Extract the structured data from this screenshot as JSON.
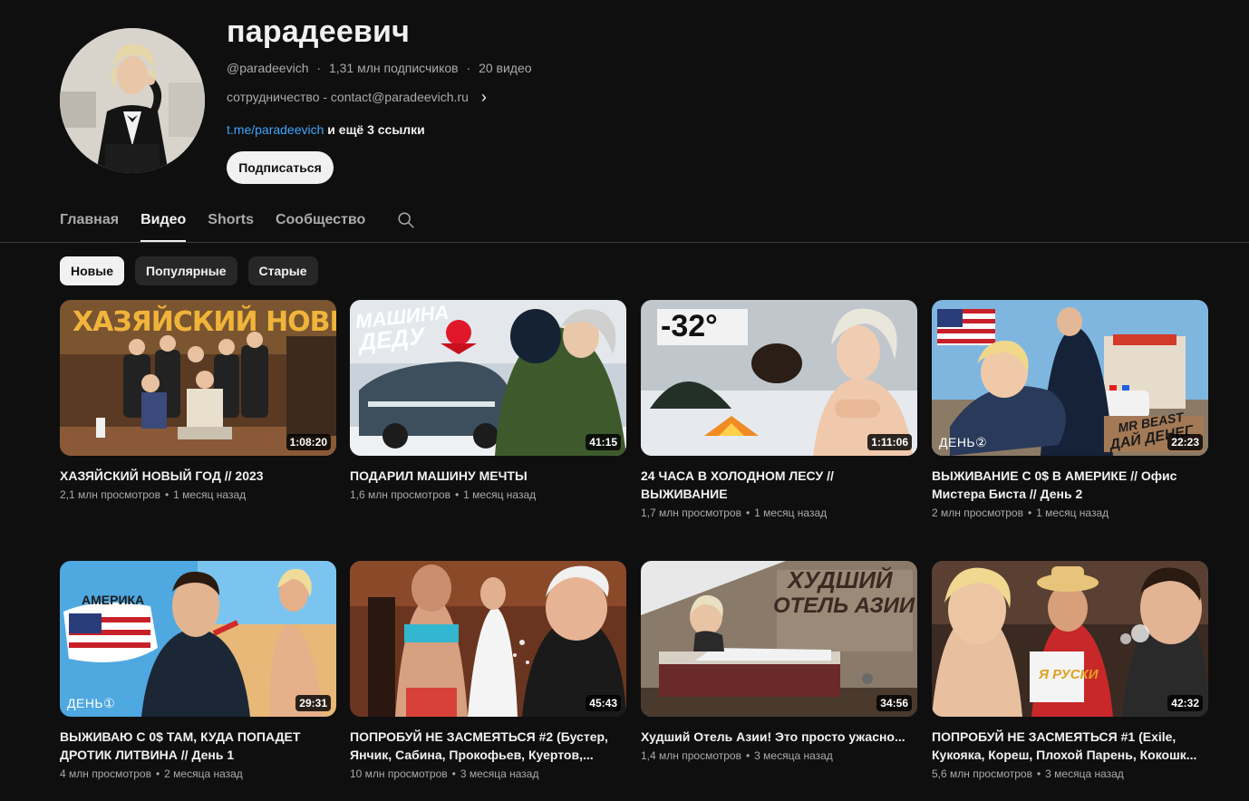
{
  "channel": {
    "name": "парадеевич",
    "handle": "@paradeevich",
    "subscribers": "1,31 млн подписчиков",
    "video_count": "20 видео",
    "separator": "·",
    "description": "сотрудничество - contact@paradeevich.ru",
    "link_primary": "t.me/paradeevich",
    "link_more": "и ещё 3 ссылки",
    "subscribe_label": "Подписаться"
  },
  "tabs": [
    {
      "label": "Главная",
      "active": false
    },
    {
      "label": "Видео",
      "active": true
    },
    {
      "label": "Shorts",
      "active": false
    },
    {
      "label": "Сообщество",
      "active": false
    }
  ],
  "filters": [
    {
      "label": "Новые",
      "active": true
    },
    {
      "label": "Популярные",
      "active": false
    },
    {
      "label": "Старые",
      "active": false
    }
  ],
  "meta_separator": "•",
  "videos": [
    {
      "title": "ХАЗЯЙСКИЙ НОВЫЙ ГОД // 2023",
      "views": "2,1 млн просмотров",
      "age": "1 месяц назад",
      "duration": "1:08:20",
      "thumb_text": "ХАЗЯЙСКИЙ НОВЫЙ ГОД"
    },
    {
      "title": "ПОДАРИЛ МАШИНУ МЕЧТЫ",
      "views": "1,6 млн просмотров",
      "age": "1 месяц назад",
      "duration": "41:15",
      "thumb_text_1": "МАШИНА",
      "thumb_text_2": "ДЕДУ"
    },
    {
      "title": "24 ЧАСА В ХОЛОДНОМ ЛЕСУ // ВЫЖИВАНИЕ",
      "views": "1,7 млн просмотров",
      "age": "1 месяц назад",
      "duration": "1:11:06",
      "thumb_text": "-32°"
    },
    {
      "title": "ВЫЖИВАНИЕ С 0$ В АМЕРИКЕ // Офис Мистера Биста // День 2",
      "views": "2 млн просмотров",
      "age": "1 месяц назад",
      "duration": "22:23",
      "thumb_text_1": "MR BEAST",
      "thumb_text_2": "ДАЙ ДЕНЕГ",
      "day_badge": "ДЕНЬ②"
    },
    {
      "title": "ВЫЖИВАЮ С 0$ ТАМ, КУДА ПОПАДЕТ ДРОТИК ЛИТВИНА // День 1",
      "views": "4 млн просмотров",
      "age": "2 месяца назад",
      "duration": "29:31",
      "thumb_text": "АМЕРИКА",
      "day_badge": "ДЕНЬ①"
    },
    {
      "title": "ПОПРОБУЙ НЕ ЗАСМЕЯТЬСЯ #2 (Бустер, Янчик, Сабина, Прокофьев, Куертов,...",
      "views": "10 млн просмотров",
      "age": "3 месяца назад",
      "duration": "45:43"
    },
    {
      "title": "Худший Отель Азии! Это просто ужасно...",
      "views": "1,4 млн просмотров",
      "age": "3 месяца назад",
      "duration": "34:56",
      "thumb_text_1": "ХУДШИЙ",
      "thumb_text_2": "ОТЕЛЬ АЗИИ"
    },
    {
      "title": "ПОПРОБУЙ НЕ ЗАСМЕЯТЬСЯ #1 (Exile, Кукояка, Кореш, Плохой Парень, Кокошк...",
      "views": "5,6 млн просмотров",
      "age": "3 месяца назад",
      "duration": "42:32",
      "thumb_text": "Я РУСКИ"
    }
  ]
}
